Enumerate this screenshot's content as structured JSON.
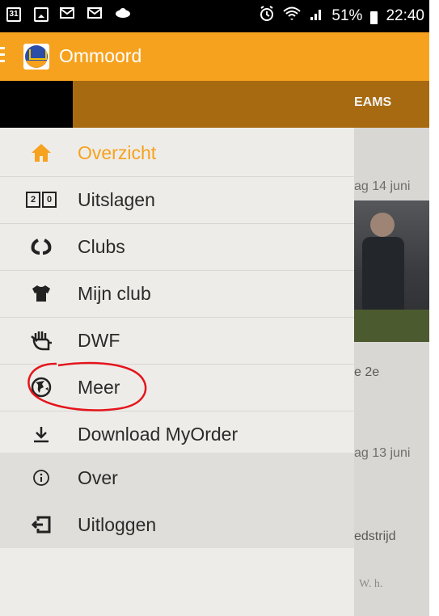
{
  "status_bar": {
    "calendar_day": "31",
    "battery": "51%",
    "time": "22:40"
  },
  "app_bar": {
    "title": "Ommoord"
  },
  "tabs": {
    "visible_tab": "EAMS"
  },
  "drawer": {
    "items": [
      {
        "label": "Overzicht",
        "icon": "home-icon",
        "active": true
      },
      {
        "label": "Uitslagen",
        "icon": "scoreboard-icon",
        "score_left": "2",
        "score_right": "0"
      },
      {
        "label": "Clubs",
        "icon": "laurel-icon"
      },
      {
        "label": "Mijn club",
        "icon": "shirt-icon"
      },
      {
        "label": "DWF",
        "icon": "hand-icon"
      },
      {
        "label": "Meer",
        "icon": "globe-icon"
      },
      {
        "label": "Download MyOrder",
        "icon": "download-icon"
      },
      {
        "label": "Over",
        "icon": "info-icon"
      },
      {
        "label": "Uitloggen",
        "icon": "logout-icon"
      }
    ]
  },
  "background": {
    "date_1": "ag 14 juni",
    "text_1": "e 2e",
    "date_2": "ag 13 juni",
    "text_2": "edstrijd",
    "sponsor": "W. h."
  },
  "colors": {
    "accent": "#f6a21e",
    "status_bar": "#000000",
    "drawer_bg": "#eeece8",
    "annotation": "#e4151c"
  }
}
